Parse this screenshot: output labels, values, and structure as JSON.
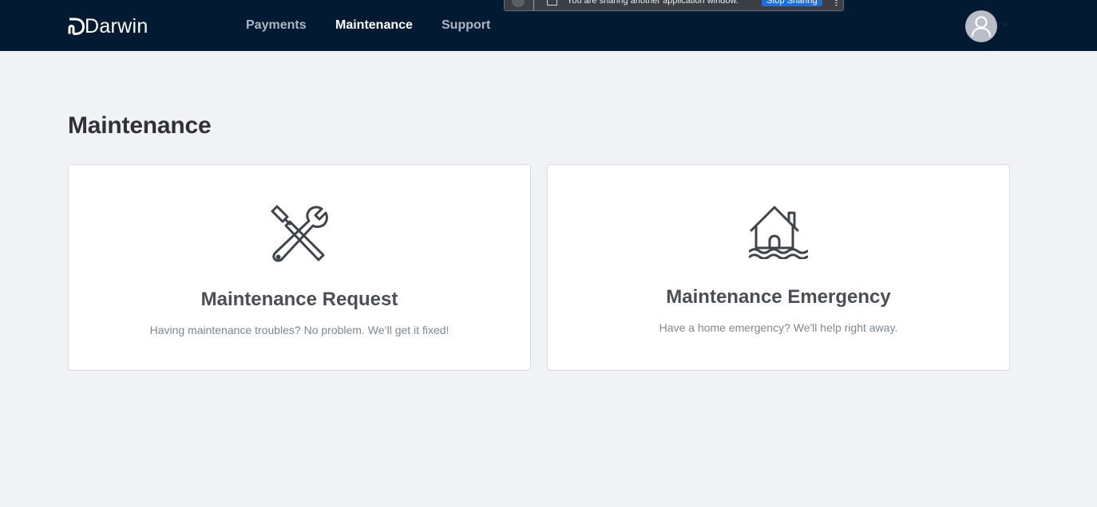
{
  "header": {
    "logo_text": "Darwin",
    "nav": [
      {
        "label": "Payments",
        "active": false
      },
      {
        "label": "Maintenance",
        "active": true
      },
      {
        "label": "Support",
        "active": false
      }
    ]
  },
  "share_banner": {
    "message": "You are sharing another application window.",
    "stop_label": "Stop Sharing"
  },
  "main": {
    "title": "Maintenance",
    "cards": [
      {
        "icon": "tools-icon",
        "title": "Maintenance Request",
        "description": "Having maintenance troubles? No problem. We’ll get it fixed!"
      },
      {
        "icon": "house-flood-icon",
        "title": "Maintenance Emergency",
        "description": "Have a home emergency? We'll help right away."
      }
    ]
  },
  "colors": {
    "nav_background": "#031a33",
    "page_background": "#f0f2f5",
    "active_nav": "#ffffff",
    "inactive_nav": "#aeb6c2",
    "stop_button": "#1a6fe0"
  }
}
